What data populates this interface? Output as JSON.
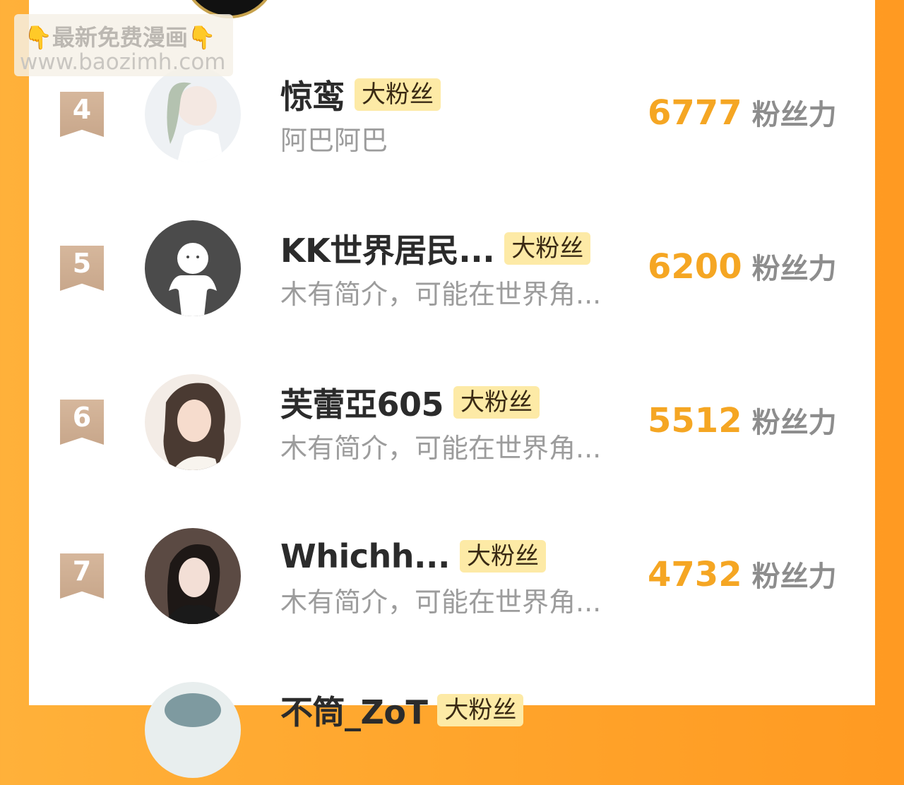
{
  "watermark": {
    "line1": "最新免费漫画",
    "line2": "www.baozimh.com",
    "hand_icon": "👇"
  },
  "fans_unit": "粉丝力",
  "entries": [
    {
      "rank": "4",
      "name": "惊鸾",
      "badge": "大粉丝",
      "intro": "阿巴阿巴",
      "score": "6777",
      "avatar_bg": "#e8edf1"
    },
    {
      "rank": "5",
      "name": "KK世界居民...",
      "badge": "大粉丝",
      "intro": "木有简介，可能在世界角...",
      "score": "6200",
      "avatar_bg": "#4a4a4a"
    },
    {
      "rank": "6",
      "name": "芙蕾亞605",
      "badge": "大粉丝",
      "intro": "木有简介，可能在世界角...",
      "score": "5512",
      "avatar_bg": "#6b5446"
    },
    {
      "rank": "7",
      "name": "Whichh...",
      "badge": "大粉丝",
      "intro": "木有简介，可能在世界角...",
      "score": "4732",
      "avatar_bg": "#3a2f2c"
    },
    {
      "rank": "",
      "name": "不筒_ZoT",
      "badge": "大粉丝",
      "intro": "",
      "score": "",
      "avatar_bg": "#9fb3b5"
    }
  ]
}
